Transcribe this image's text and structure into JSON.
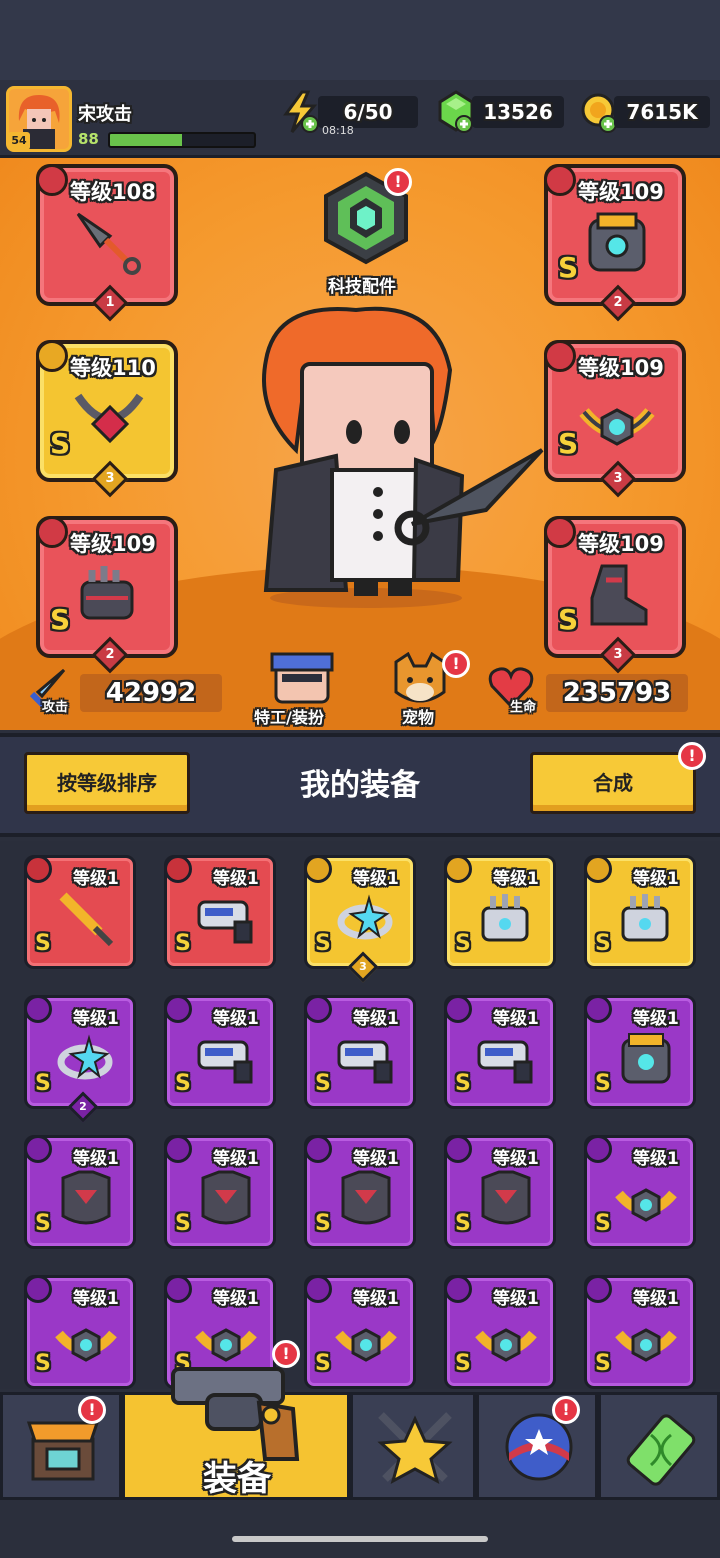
{
  "player": {
    "name": "宋攻击",
    "level": "88",
    "avatar_level": "54",
    "xp_fraction": 0.5
  },
  "resources": {
    "energy": "6/50",
    "energy_timer": "08:18",
    "gems": "13526",
    "coins": "7615K"
  },
  "tech": {
    "label": "科技配件",
    "alert": "!"
  },
  "equipped": {
    "left": [
      {
        "level": "等级108",
        "stars": "1",
        "rarity": "",
        "icon": "dagger-icon"
      },
      {
        "level": "等级110",
        "stars": "3",
        "rarity": "S",
        "icon": "necklace-icon"
      },
      {
        "level": "等级109",
        "stars": "2",
        "rarity": "S",
        "icon": "gauntlet-icon"
      }
    ],
    "right": [
      {
        "level": "等级109",
        "stars": "2",
        "rarity": "S",
        "icon": "armor-icon"
      },
      {
        "level": "等级109",
        "stars": "3",
        "rarity": "S",
        "icon": "belt-icon"
      },
      {
        "level": "等级109",
        "stars": "3",
        "rarity": "S",
        "icon": "boot-icon"
      }
    ]
  },
  "stats": {
    "attack_label": "攻击",
    "attack": "42992",
    "hp_label": "生命",
    "hp": "235793"
  },
  "middle_buttons": {
    "agent": "特工/装扮",
    "pet": "宠物"
  },
  "list": {
    "sort_button": "按等级排序",
    "title": "我的装备",
    "merge_button": "合成",
    "alert": "!"
  },
  "inventory": [
    {
      "level": "等级1",
      "color": "red",
      "rarity": "S",
      "icon": "sword-icon",
      "stars": ""
    },
    {
      "level": "等级1",
      "color": "red",
      "rarity": "S",
      "icon": "blaster-icon",
      "stars": ""
    },
    {
      "level": "等级1",
      "color": "gold",
      "rarity": "S",
      "icon": "ring-icon",
      "stars": "3"
    },
    {
      "level": "等级1",
      "color": "gold",
      "rarity": "S",
      "icon": "gauntlet-icon",
      "stars": ""
    },
    {
      "level": "等级1",
      "color": "gold",
      "rarity": "S",
      "icon": "gauntlet-icon",
      "stars": ""
    },
    {
      "level": "等级1",
      "color": "purple",
      "rarity": "S",
      "icon": "ring-icon",
      "stars": "2"
    },
    {
      "level": "等级1",
      "color": "purple",
      "rarity": "S",
      "icon": "blaster-icon",
      "stars": ""
    },
    {
      "level": "等级1",
      "color": "purple",
      "rarity": "S",
      "icon": "blaster-icon",
      "stars": ""
    },
    {
      "level": "等级1",
      "color": "purple",
      "rarity": "S",
      "icon": "blaster-icon",
      "stars": ""
    },
    {
      "level": "等级1",
      "color": "purple",
      "rarity": "S",
      "icon": "armor-icon",
      "stars": ""
    },
    {
      "level": "等级1",
      "color": "purple",
      "rarity": "S",
      "icon": "chestplate-icon",
      "stars": ""
    },
    {
      "level": "等级1",
      "color": "purple",
      "rarity": "S",
      "icon": "chestplate-icon",
      "stars": ""
    },
    {
      "level": "等级1",
      "color": "purple",
      "rarity": "S",
      "icon": "chestplate-icon",
      "stars": ""
    },
    {
      "level": "等级1",
      "color": "purple",
      "rarity": "S",
      "icon": "chestplate-icon",
      "stars": ""
    },
    {
      "level": "等级1",
      "color": "purple",
      "rarity": "S",
      "icon": "belt-icon",
      "stars": ""
    },
    {
      "level": "等级1",
      "color": "purple",
      "rarity": "S",
      "icon": "belt-icon",
      "stars": ""
    },
    {
      "level": "等级1",
      "color": "purple",
      "rarity": "S",
      "icon": "belt-icon",
      "stars": ""
    },
    {
      "level": "等级1",
      "color": "purple",
      "rarity": "S",
      "icon": "belt-icon",
      "stars": ""
    },
    {
      "level": "等级1",
      "color": "purple",
      "rarity": "S",
      "icon": "belt-icon",
      "stars": ""
    },
    {
      "level": "等级1",
      "color": "purple",
      "rarity": "S",
      "icon": "belt-icon",
      "stars": ""
    }
  ],
  "nav": {
    "items": [
      {
        "icon": "shop-icon",
        "label": "",
        "alert": "!"
      },
      {
        "icon": "revolver-icon",
        "label": "装备",
        "alert": ""
      },
      {
        "icon": "star-swords-icon",
        "label": "",
        "alert": ""
      },
      {
        "icon": "orb-icon",
        "label": "",
        "alert": "!"
      },
      {
        "icon": "dna-battery-icon",
        "label": "",
        "alert": ""
      }
    ]
  },
  "colors": {
    "arena": "#f59a2e",
    "red_card": "#e44b51",
    "gold_card": "#f4c531",
    "purple_card": "#9a38c7",
    "accent_yellow": "#f7c937"
  }
}
